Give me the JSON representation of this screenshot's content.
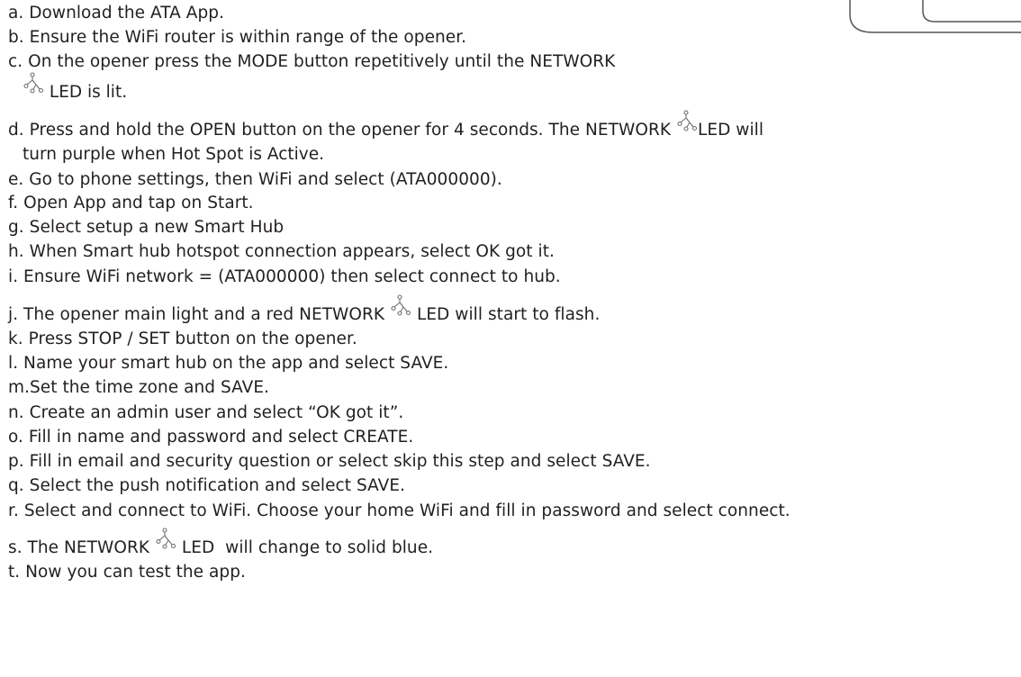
{
  "document": {
    "steps": [
      {
        "text": "a. Download the ATA App."
      },
      {
        "text": "b. Ensure the WiFi router is within range of the opener."
      },
      {
        "text": "c. On the opener press the MODE button repetitively until the NETWORK"
      },
      {
        "text_after_icon": " LED is lit."
      },
      {
        "text_before_icon": "d. Press and hold the OPEN button on the opener for 4 seconds. The NETWORK ",
        "text_after_icon": "LED will"
      },
      {
        "text": "turn purple when Hot Spot is Active."
      },
      {
        "text": "e. Go to phone settings, then WiFi and select (ATA000000)."
      },
      {
        "text": "f. Open App and tap on Start."
      },
      {
        "text": "g. Select setup a new Smart Hub"
      },
      {
        "text": "h. When Smart hub hotspot connection appears, select OK got it."
      },
      {
        "text": "i. Ensure WiFi network = (ATA000000) then select connect to hub."
      },
      {
        "text_before_icon": "j. The opener main light and a red NETWORK ",
        "text_after_icon": " LED will start to flash."
      },
      {
        "text": "k. Press STOP / SET button on the opener."
      },
      {
        "text": "l. Name your smart hub on the app and select SAVE."
      },
      {
        "text": "m.Set the time zone and SAVE."
      },
      {
        "text": "n. Create an admin user and select “OK got it”."
      },
      {
        "text": "o. Fill in name and password and select CREATE."
      },
      {
        "text": "p. Fill in email and security question or select skip this step and select SAVE."
      },
      {
        "text": "q. Select the push notification and select SAVE."
      },
      {
        "text": "r. Select and connect to WiFi. Choose your home WiFi and fill in password and select connect."
      },
      {
        "text_before_icon": "s. The NETWORK ",
        "text_after_icon": " LED  will change to solid blue."
      },
      {
        "text": "t. Now you can test the app."
      }
    ]
  },
  "icons": {
    "network_led": "network-icon"
  }
}
